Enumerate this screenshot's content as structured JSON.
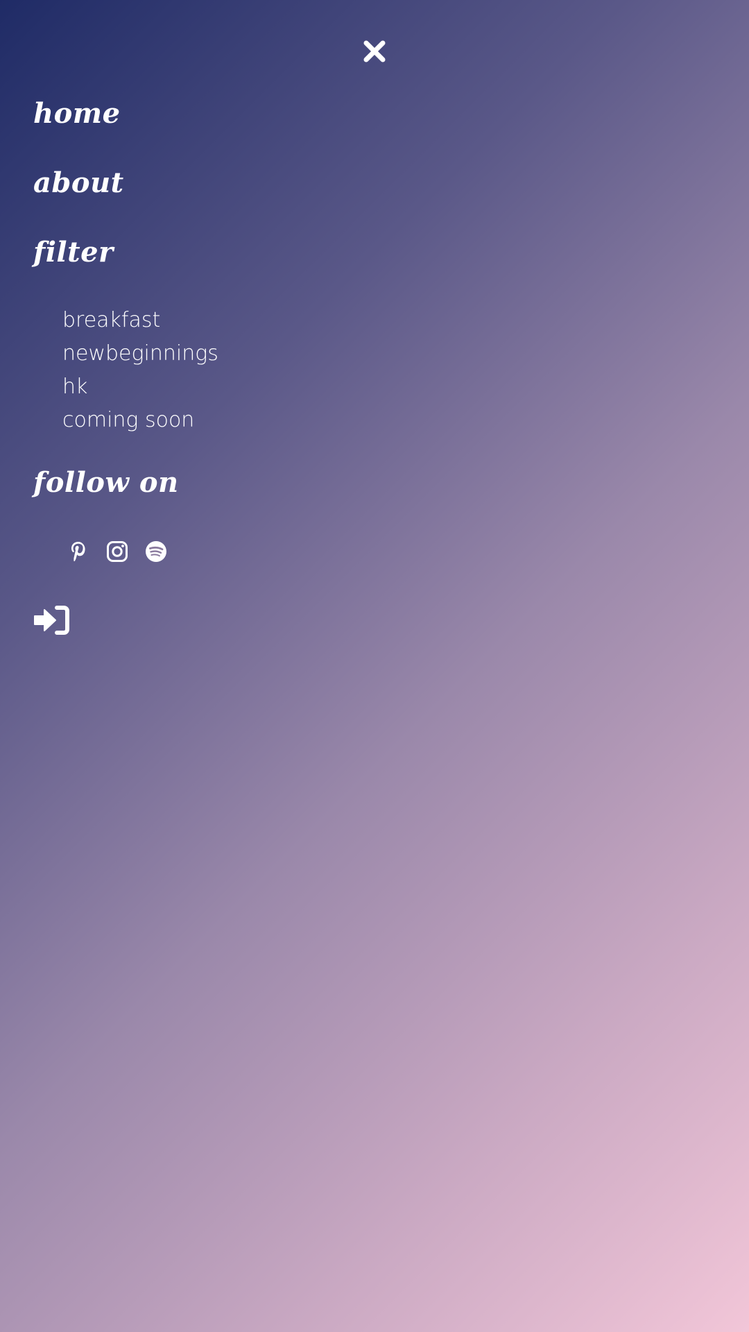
{
  "menu": {
    "close_icon": "close-icon",
    "items": [
      {
        "label": "home"
      },
      {
        "label": "about"
      },
      {
        "label": "filter"
      }
    ]
  },
  "filter": {
    "options": [
      "breakfast",
      "newbeginnings",
      "hk",
      "coming soon"
    ]
  },
  "follow": {
    "heading": "follow on",
    "icons": [
      "pinterest-icon",
      "instagram-icon",
      "spotify-icon"
    ]
  },
  "login": {
    "icon": "sign-in-icon"
  },
  "colors": {
    "gradient_start": "#1f2b66",
    "gradient_end": "#f2c6d8",
    "text": "#ffffff"
  }
}
